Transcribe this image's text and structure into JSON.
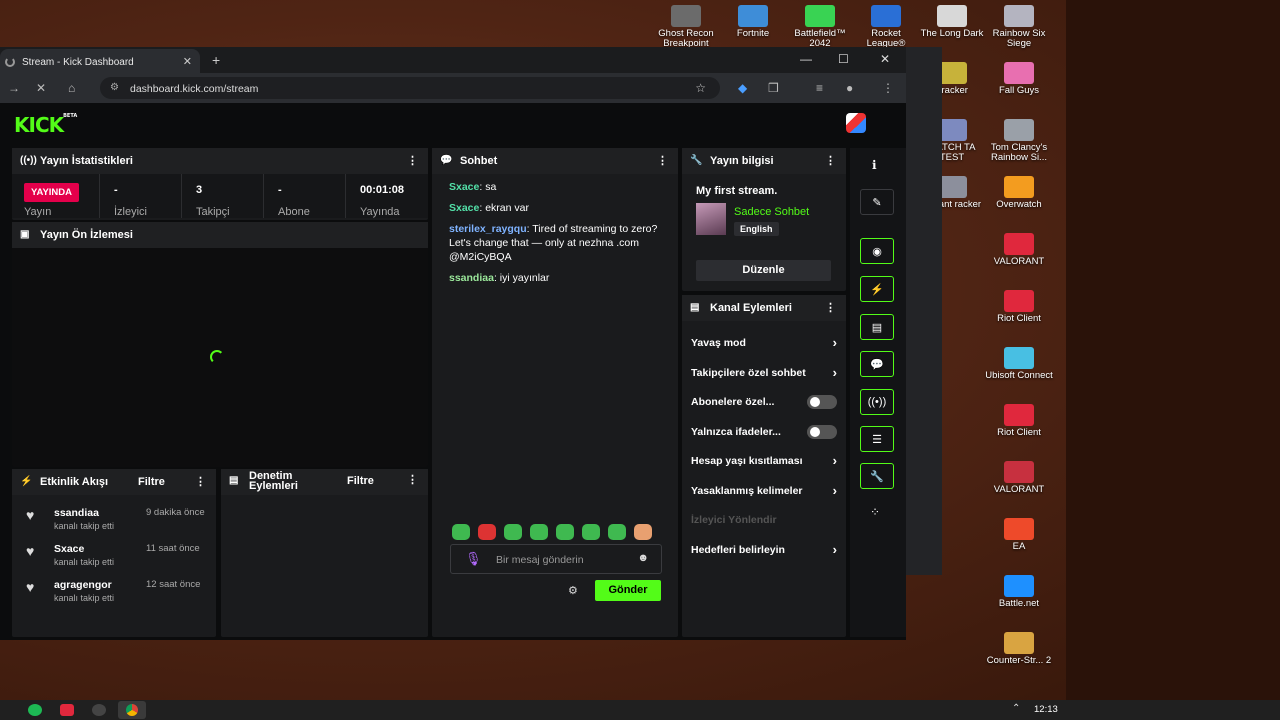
{
  "desktop": {
    "icons": [
      {
        "label": "Ghost Recon Breakpoint",
        "color": "#6b6b6b"
      },
      {
        "label": "Fortnite",
        "color": "#3e8dd8"
      },
      {
        "label": "Battlefield™ 2042",
        "color": "#39d353"
      },
      {
        "label": "Rocket League®",
        "color": "#2a6fd6"
      },
      {
        "label": "The Long Dark",
        "color": "#d8d8d8"
      },
      {
        "label": "Rainbow Six Siege",
        "color": "#b4b4c0"
      },
      {
        "label": "Tracker",
        "color": "#c7b23a"
      },
      {
        "label": "Fall Guys",
        "color": "#e86fb0"
      },
      {
        "label": "MATCH TA TEST",
        "color": "#7d8abf"
      },
      {
        "label": "Tom Clancy's Rainbow Si...",
        "color": "#9aa0a8"
      },
      {
        "label": "alorant racker",
        "color": "#8c8f9c"
      },
      {
        "label": "Overwatch",
        "color": "#f39c1f"
      },
      {
        "label": "VALORANT",
        "color": "#e0283d"
      },
      {
        "label": "Riot Client",
        "color": "#e0283d"
      },
      {
        "label": "Ubisoft Connect",
        "color": "#48bfe3"
      },
      {
        "label": "Riot Client",
        "color": "#e0283d"
      },
      {
        "label": "VALORANT",
        "color": "#c7303f"
      },
      {
        "label": "EA",
        "color": "#ee4a2a"
      },
      {
        "label": "Battle.net",
        "color": "#1e90ff"
      },
      {
        "label": "Counter-Str... 2",
        "color": "#d9a441"
      }
    ]
  },
  "browser": {
    "tab_title": "Stream - Kick Dashboard",
    "new_tab": "+",
    "url": "dashboard.kick.com/stream",
    "min": "—",
    "max": "☐",
    "close": "✕",
    "tab_close": "✕"
  },
  "kick": {
    "logo": "KICK",
    "beta": "BETA",
    "stats": {
      "title": "Yayın İstatistikleri",
      "live": "YAYINDA",
      "live_label": "Yayın",
      "viewers_value": "-",
      "viewers_label": "İzleyici",
      "followers_value": "3",
      "followers_label": "Takipçi",
      "subs_value": "-",
      "subs_label": "Abone",
      "uptime_value": "00:01:08",
      "uptime_label": "Yayında"
    },
    "preview": {
      "title": "Yayın Ön İzlemesi"
    },
    "activity": {
      "title": "Etkinlik Akışı",
      "filter": "Filtre",
      "items": [
        {
          "user": "ssandiaa",
          "time": "9 dakika önce",
          "text": "kanalı takip etti"
        },
        {
          "user": "Sxace",
          "time": "11 saat önce",
          "text": "kanalı takip etti"
        },
        {
          "user": "agragengor",
          "time": "12 saat önce",
          "text": "kanalı takip etti"
        }
      ]
    },
    "moderation": {
      "title": "Denetim Eylemleri",
      "filter": "Filtre"
    },
    "chat": {
      "title": "Sohbet",
      "placeholder": "Bir mesaj gönderin",
      "send": "Gönder",
      "messages": [
        {
          "user": "Sxace",
          "color": "#53e0a8",
          "text": "sa"
        },
        {
          "user": "Sxace",
          "color": "#53e0a8",
          "text": "ekran var"
        },
        {
          "user": "sterilex_raygqu",
          "color": "#7fb3ff",
          "text": "Tired of streaming to zero? Let's change that — only at nezhna .com @M2iCyBQA"
        },
        {
          "user": "ssandiaa",
          "color": "#9be89b",
          "text": "iyi yayınlar"
        }
      ]
    },
    "info": {
      "title": "Yayın bilgisi",
      "stream_title": "My first stream.",
      "category": "Sadece Sohbet",
      "language": "English",
      "edit": "Düzenle"
    },
    "channel_actions": {
      "title": "Kanal Eylemleri",
      "items": [
        {
          "label": "Yavaş mod",
          "type": "arrow"
        },
        {
          "label": "Takipçilere özel sohbet",
          "type": "arrow"
        },
        {
          "label": "Abonelere özel...",
          "type": "toggle"
        },
        {
          "label": "Yalnızca ifadeler...",
          "type": "toggle"
        },
        {
          "label": "Hesap yaşı kısıtlaması",
          "type": "arrow"
        },
        {
          "label": "Yasaklanmış kelimeler",
          "type": "arrow"
        },
        {
          "label": "İzleyici Yönlendir",
          "type": "disabled"
        },
        {
          "label": "Hedefleri belirleyin",
          "type": "arrow"
        }
      ]
    }
  },
  "taskbar": {
    "time": "12:13"
  }
}
